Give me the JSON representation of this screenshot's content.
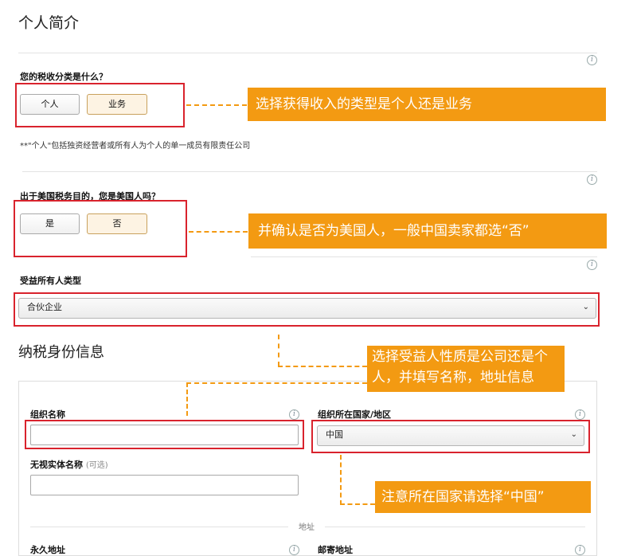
{
  "page": {
    "title": "个人简介",
    "section2_title": "纳税身份信息"
  },
  "tax_class": {
    "question": "您的税收分类是什么？",
    "options": [
      "个人",
      "业务"
    ],
    "selected": "业务",
    "note": "**\"个人\"包括独资经营者或所有人为个人的单一成员有限责任公司"
  },
  "us_person": {
    "question": "出于美国税务目的，您是美国人吗？",
    "options": [
      "是",
      "否"
    ],
    "selected": "否"
  },
  "beneficiary": {
    "label": "受益所有人类型",
    "value": "合伙企业"
  },
  "tax_identity": {
    "org_name_label": "组织名称",
    "org_name_value": "",
    "country_label": "组织所在国家/地区",
    "country_value": "中国",
    "dba_label": "无视实体名称",
    "dba_optional": "(可选)",
    "dba_value": "",
    "address_divider": "地址",
    "permanent_address_label": "永久地址",
    "mailing_address_label": "邮寄地址"
  },
  "callouts": {
    "c1": "选择获得收入的类型是个人还是业务",
    "c2": "并确认是否为美国人，一般中国卖家都选“否”",
    "c3_line1": "选择受益人性质是公司还是个",
    "c3_line2": "人，并填写名称，地址信息",
    "c4": "注意所在国家请选择“中国”"
  },
  "icons": {
    "info": "i",
    "chevron": "⌄"
  },
  "colors": {
    "callout_bg": "#f39a12",
    "highlight_border": "#d9232d",
    "selected_button_bg": "#fdf3e3"
  }
}
